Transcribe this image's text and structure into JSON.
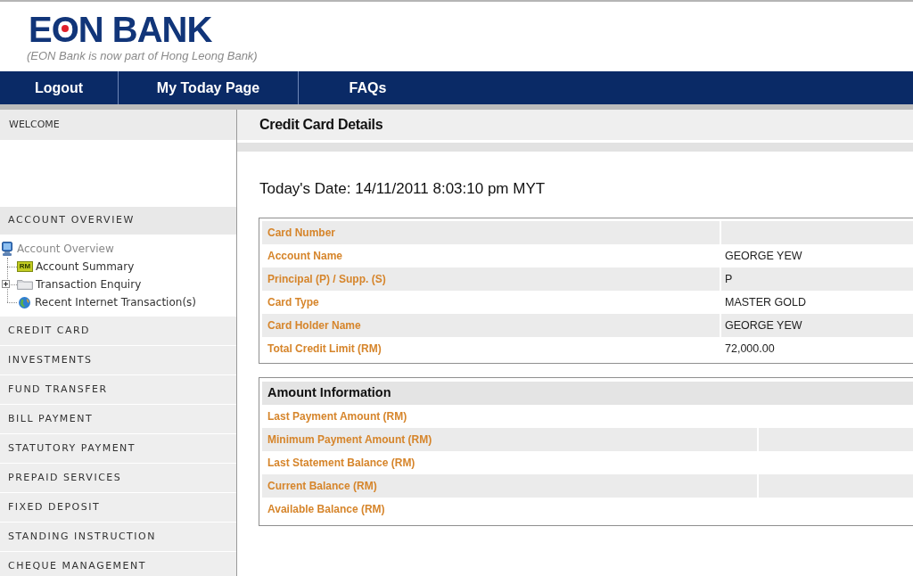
{
  "header": {
    "logo": "EON BANK",
    "tagline": "(EON Bank is now part of Hong Leong Bank)"
  },
  "nav": [
    {
      "label": "Logout"
    },
    {
      "label": "My Today Page"
    },
    {
      "label": "FAQs"
    }
  ],
  "sidebar": {
    "welcome": "WELCOME",
    "overview": {
      "title": "ACCOUNT OVERVIEW",
      "tree": {
        "label": "Account Overview",
        "children": [
          {
            "label": "Account Summary",
            "badge": "RM",
            "expandable": false
          },
          {
            "label": "Transaction Enquiry",
            "expandable": true,
            "expanded": false
          },
          {
            "label": "Recent Internet Transaction(s)",
            "expandable": false
          }
        ]
      }
    },
    "sections": [
      "CREDIT CARD",
      "INVESTMENTS",
      "FUND TRANSFER",
      "BILL PAYMENT",
      "STATUTORY PAYMENT",
      "PREPAID SERVICES",
      "FIXED DEPOSIT",
      "STANDING INSTRUCTION",
      "CHEQUE MANAGEMENT"
    ]
  },
  "main": {
    "title": "Credit Card Details",
    "date": "Today's Date: 14/11/2011 8:03:10 pm MYT",
    "card_details": [
      {
        "label": "Card Number"
      },
      {
        "label": "Account Name",
        "value": "GEORGE YEW"
      },
      {
        "label": "Principal (P) / Supp. (S)",
        "value": "P"
      },
      {
        "label": "Card Type",
        "value": "MASTER GOLD"
      },
      {
        "label": "Card Holder Name",
        "value": "GEORGE YEW"
      },
      {
        "label": "Total Credit Limit (RM)",
        "value": "72,000.00"
      }
    ],
    "amount_information": {
      "title": "Amount Information",
      "rows": [
        {
          "label": "Last Payment Amount (RM)"
        },
        {
          "label": "Minimum Payment Amount (RM)"
        },
        {
          "label": "Last Statement Balance (RM)"
        },
        {
          "label": "Current Balance (RM)"
        },
        {
          "label": "Available Balance (RM)"
        }
      ]
    }
  }
}
